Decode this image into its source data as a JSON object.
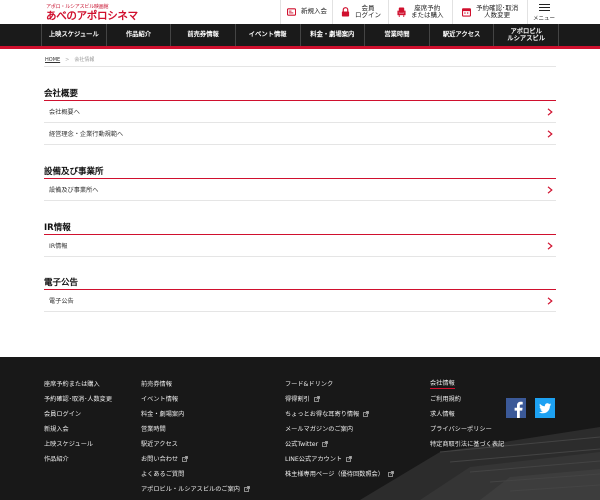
{
  "header": {
    "logo_tagline": "アポロ・ルシアスビル映画館",
    "logo_name": "あべのアポロシネマ",
    "buttons": [
      {
        "label": "新規入会",
        "icon": "member-card-icon"
      },
      {
        "label": "会員\nログイン",
        "icon": "lock-icon"
      },
      {
        "label": "座席予約\nまたは購入",
        "icon": "seat-icon"
      },
      {
        "label": "予約確認･取消\n人数変更",
        "icon": "calendar-icon"
      }
    ],
    "menu_label": "メニュー"
  },
  "nav": {
    "items": [
      "上映スケジュール",
      "作品紹介",
      "前売券情報",
      "イベント情報",
      "料金・劇場案内",
      "営業時間",
      "駅近アクセス",
      "アポロビル\nルシアスビル"
    ]
  },
  "breadcrumb": {
    "home": "HOME",
    "separator": ">",
    "current": "会社情報"
  },
  "sections": [
    {
      "title": "会社概要",
      "items": [
        "会社概要へ",
        "経営理念・企業行動規範へ"
      ]
    },
    {
      "title": "設備及び事業所",
      "items": [
        "設備及び事業所へ"
      ]
    },
    {
      "title": "IR情報",
      "items": [
        "IR情報"
      ]
    },
    {
      "title": "電子公告",
      "items": [
        "電子公告"
      ]
    }
  ],
  "footer": {
    "col1": [
      "座席予約または購入",
      "予約確認･取消･人数変更",
      "会員ログイン",
      "新規入会",
      "上映スケジュール",
      "作品紹介"
    ],
    "col2": [
      "前売券情報",
      "イベント情報",
      "料金・劇場案内",
      "営業時間",
      "駅近アクセス",
      "お問い合わせ",
      "よくあるご質問",
      "アポロビル・ルシアスビルのご案内"
    ],
    "col3": [
      "フード&ドリンク",
      "得得割引",
      "ちょっとお得な耳寄り情報",
      "メールマガジンのご案内",
      "公式Twitter",
      "LINE公式アカウント",
      "株主様専用ページ（優待回数照会）"
    ],
    "col4": [
      "会社情報",
      "ご利用規約",
      "求人情報",
      "プライバシーポリシー",
      "特定商取引法に基づく表記"
    ]
  },
  "colors": {
    "accent": "#d0102e",
    "nav_bg": "#1a1a1a",
    "footer_bg": "#181818",
    "facebook": "#3b5998",
    "twitter": "#1da1f2"
  }
}
